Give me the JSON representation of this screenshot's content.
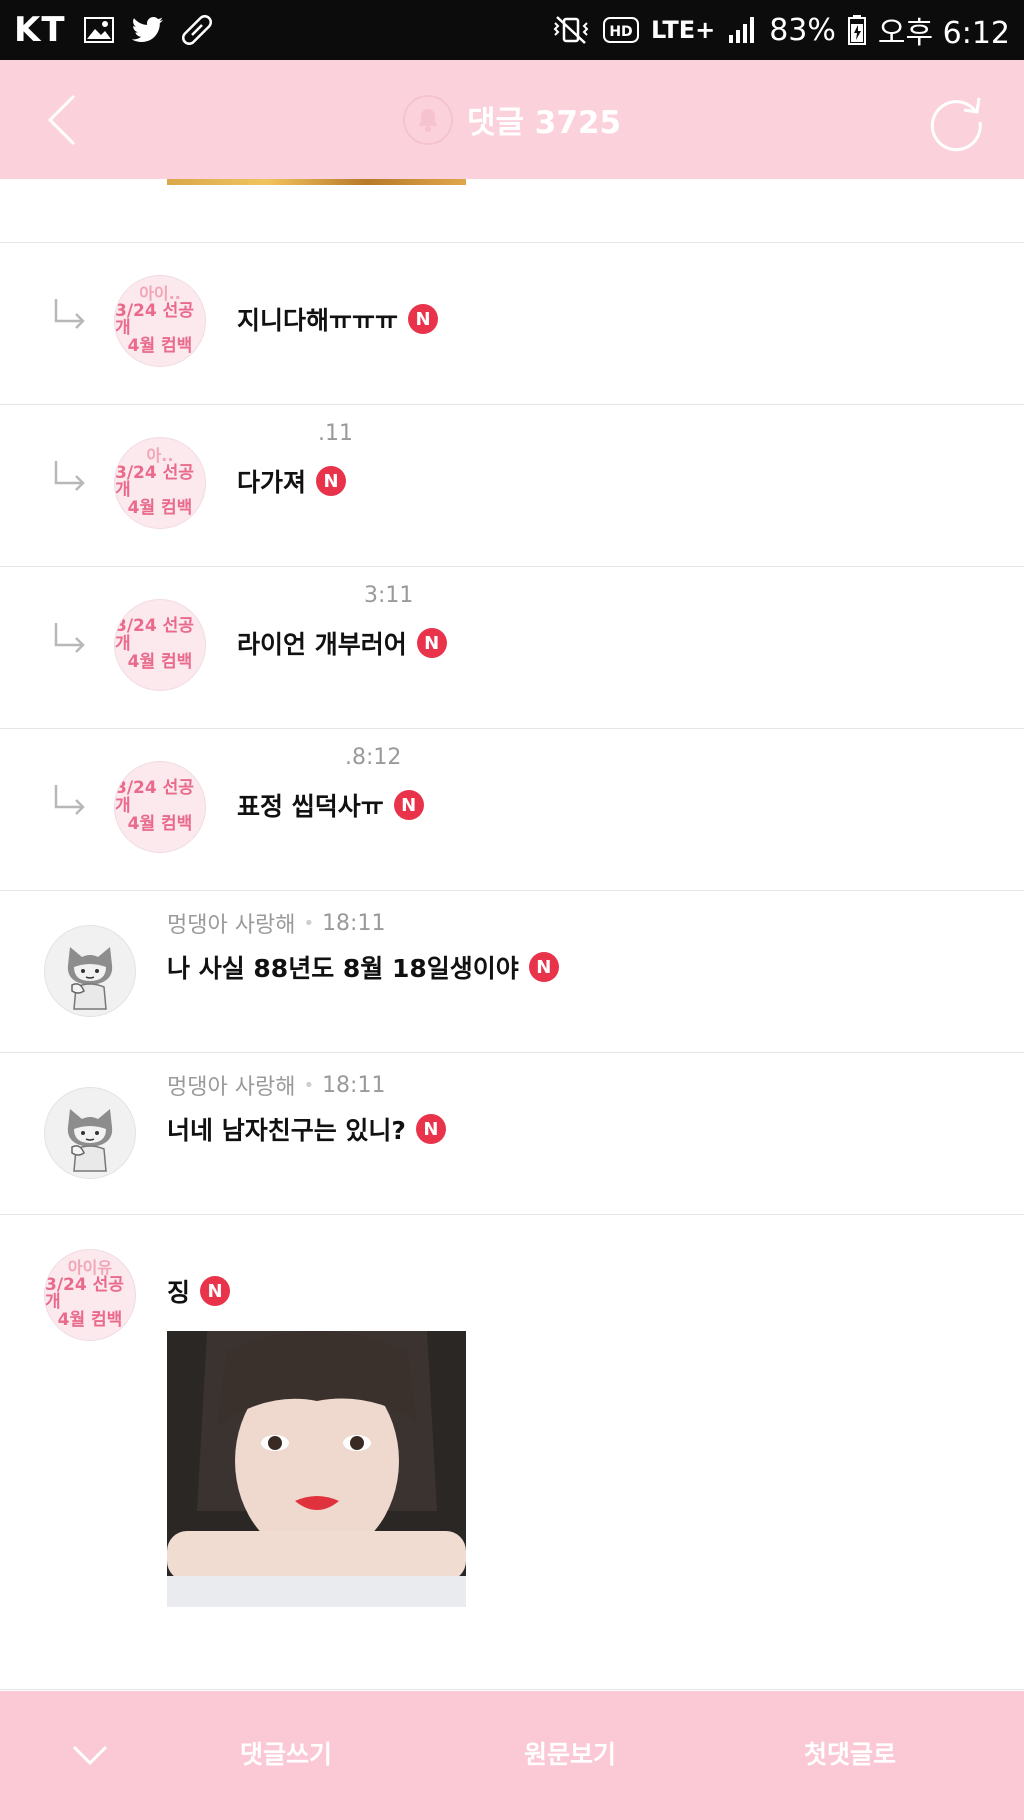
{
  "status_bar": {
    "carrier": "KT",
    "network": "LTE+",
    "battery": "83%",
    "time": "오후 6:12",
    "left_icons": [
      "gallery-icon",
      "twitter-icon",
      "pill-icon"
    ],
    "right_icons": [
      "mute-vibrate-icon",
      "hd-icon",
      "signal-icon",
      "battery-icon"
    ]
  },
  "header": {
    "title": "댓글 3725",
    "back_icon": "back-chevron-icon",
    "bell_icon": "bell-icon",
    "refresh_icon": "refresh-icon"
  },
  "comments": [
    {
      "type": "reply",
      "avatar": {
        "l1": "아이..",
        "l2": "3/24 선공개",
        "l3": "4월 컴백"
      },
      "meta_time": "",
      "text": "지니다해ㅠㅠㅠ",
      "new_badge": "N"
    },
    {
      "type": "reply",
      "avatar": {
        "l1": "아..",
        "l2": "3/24 선공개",
        "l3": "4월 컴백"
      },
      "meta_time": ".11",
      "text": "다가져",
      "new_badge": "N"
    },
    {
      "type": "reply",
      "avatar": {
        "l1": "",
        "l2": "3/24 선공개",
        "l3": "4월 컴백"
      },
      "meta_time": "3:11",
      "text": "라이언 개부러어",
      "new_badge": "N"
    },
    {
      "type": "reply",
      "avatar": {
        "l1": "",
        "l2": "3/24 선공개",
        "l3": "4월 컴백"
      },
      "meta_time": ".8:12",
      "text": "표정 씹덕사ㅠ",
      "new_badge": "N"
    },
    {
      "type": "comment",
      "author": "멍댕아 사랑해",
      "time": "18:11",
      "text": "나 사실 88년도 8월 18일생이야",
      "new_badge": "N"
    },
    {
      "type": "comment",
      "author": "멍댕아 사랑해",
      "time": "18:11",
      "text": "너네 남자친구는 있니?",
      "new_badge": "N"
    },
    {
      "type": "comment",
      "avatar": {
        "l1": "아이유",
        "l2": "3/24 선공개",
        "l3": "4월 컴백"
      },
      "meta_time": "",
      "text": "징",
      "new_badge": "N",
      "has_photo": true
    }
  ],
  "bottom_bar": {
    "down_icon": "chevron-down-icon",
    "write": "댓글쓰기",
    "original": "원문보기",
    "first": "첫댓글로"
  },
  "colors": {
    "header_bg": "#fbd2dc",
    "bottom_bg": "#fbc9d5",
    "new_badge": "#e8334b",
    "avatar_pink": "#ea6a8c"
  }
}
